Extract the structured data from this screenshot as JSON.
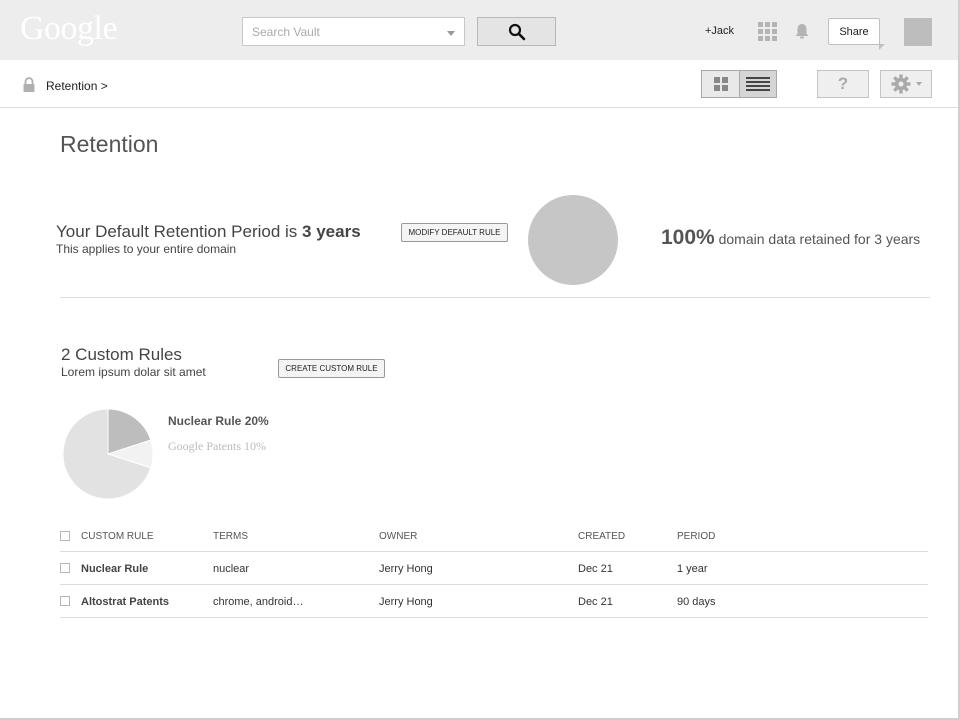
{
  "header": {
    "logo": "Google",
    "search_placeholder": "Search Vault",
    "user_link": "+Jack",
    "share_label": "Share"
  },
  "breadcrumb": {
    "label": "Retention >"
  },
  "toolbar": {
    "help_label": "?"
  },
  "page": {
    "title": "Retention"
  },
  "default_rule": {
    "heading_prefix": "Your Default Retention Period is ",
    "heading_value": "3 years",
    "subtitle": "This applies to your entire domain",
    "modify_label": "MODIFY DEFAULT RULE",
    "retained_percent": "100%",
    "retained_text": " domain data retained for 3 years"
  },
  "custom_rules": {
    "heading": "2 Custom Rules",
    "subtitle": "Lorem ipsum dolar sit amet",
    "create_label": "CREATE CUSTOM RULE",
    "legend": [
      {
        "label": "Nuclear Rule 20%",
        "color": "#bdbdbd"
      },
      {
        "label": "Google Patents 10%",
        "color": "#f2f2f2"
      }
    ]
  },
  "chart_data": {
    "type": "pie",
    "slices": [
      {
        "label": "Nuclear Rule",
        "value": 20,
        "color": "#bdbdbd"
      },
      {
        "label": "Google Patents",
        "value": 10,
        "color": "#f2f2f2"
      },
      {
        "label": "",
        "value": 70,
        "color": "#e2e2e2"
      }
    ]
  },
  "table": {
    "columns": [
      "CUSTOM RULE",
      "TERMS",
      "OWNER",
      "CREATED",
      "PERIOD"
    ],
    "rows": [
      {
        "name": "Nuclear Rule",
        "terms": "nuclear",
        "owner": "Jerry Hong",
        "created": "Dec 21",
        "period": "1 year"
      },
      {
        "name": "Altostrat Patents",
        "terms": "chrome, android…",
        "owner": "Jerry Hong",
        "created": "Dec 21",
        "period": "90 days"
      }
    ]
  }
}
